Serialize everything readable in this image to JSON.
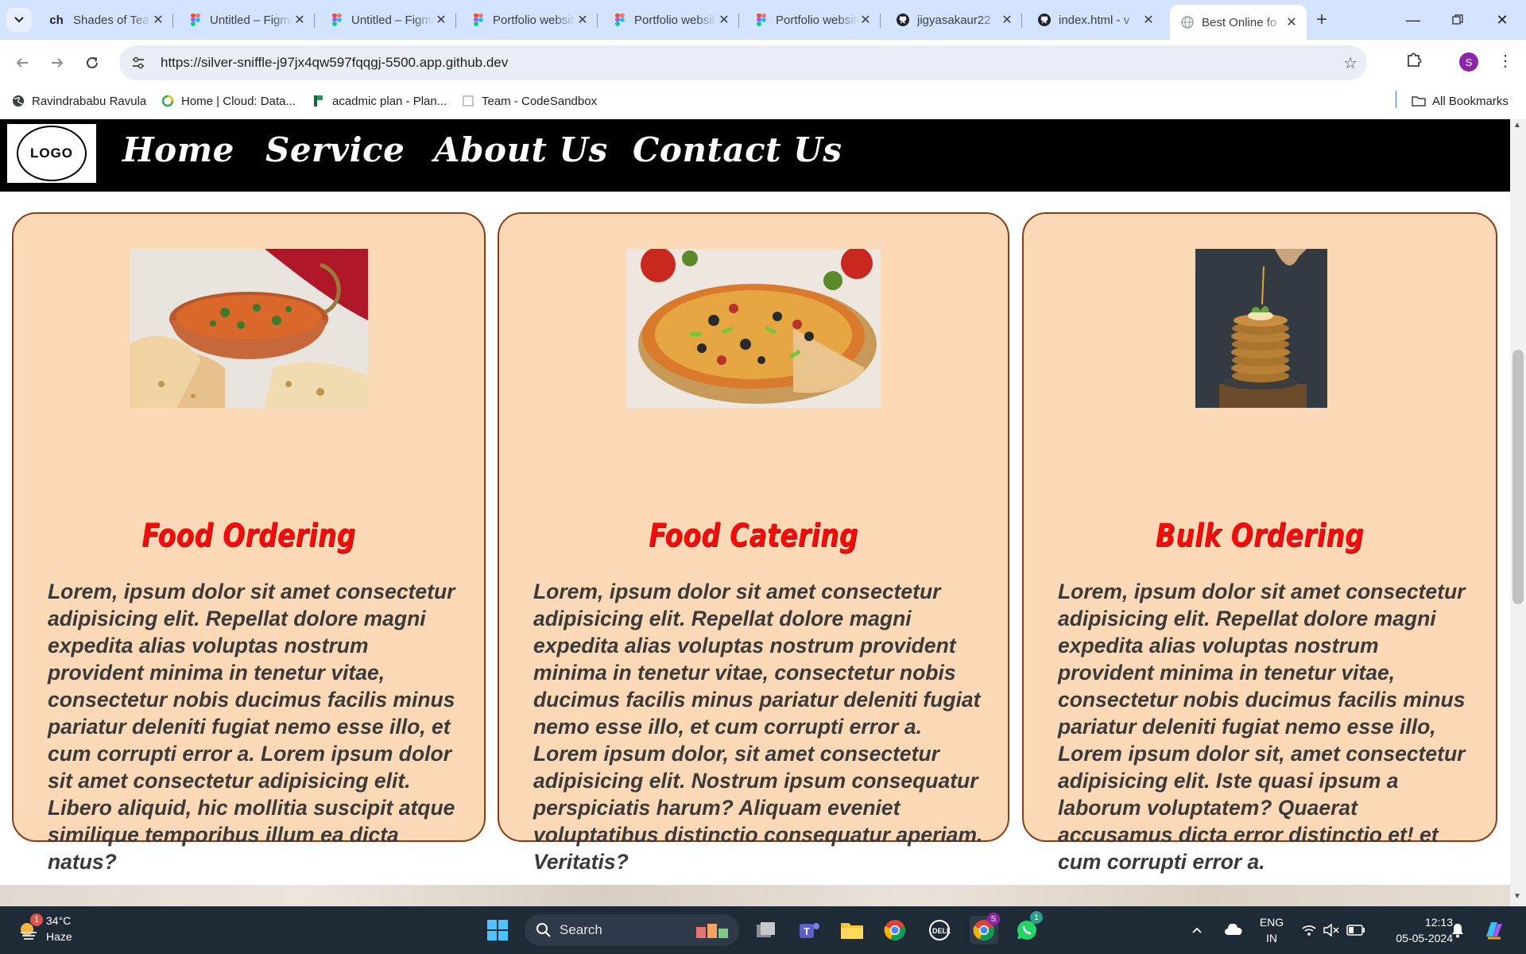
{
  "browser": {
    "tabs": [
      {
        "title": "Shades of Tea",
        "favicon": "ch",
        "active": false
      },
      {
        "title": "Untitled – Figma",
        "favicon": "figma",
        "active": false
      },
      {
        "title": "Untitled – Figma",
        "favicon": "figma",
        "active": false
      },
      {
        "title": "Portfolio website",
        "favicon": "figma",
        "active": false
      },
      {
        "title": "Portfolio website",
        "favicon": "figma",
        "active": false
      },
      {
        "title": "Portfolio website",
        "favicon": "figma",
        "active": false
      },
      {
        "title": "jigyasakaur22",
        "favicon": "github",
        "active": false
      },
      {
        "title": "index.html - v",
        "favicon": "github",
        "active": false
      },
      {
        "title": "Best Online fo",
        "favicon": "globe",
        "active": true
      }
    ],
    "url": "https://silver-sniffle-j97jx4qw597fqqgj-5500.app.github.dev",
    "profile_initial": "S",
    "bookmarks": [
      {
        "label": "Ravindrababu Ravula",
        "icon": "globe-icon"
      },
      {
        "label": "Home | Cloud: Data...",
        "icon": "ring-icon"
      },
      {
        "label": "acadmic plan - Plan...",
        "icon": "flag-icon"
      },
      {
        "label": "Team - CodeSandbox",
        "icon": "square-icon"
      }
    ],
    "all_bookmarks": "All Bookmarks"
  },
  "site": {
    "logo": "LOGO",
    "nav": [
      "Home",
      "Service",
      "About Us",
      "Contact Us"
    ],
    "cards": [
      {
        "title": "Food Ordering",
        "image": "curry-bowl-with-naan",
        "text": "Lorem, ipsum dolor sit amet consectetur adipisicing elit. Repellat dolore magni expedita alias voluptas nostrum provident minima in tenetur vitae, consectetur nobis ducimus facilis minus pariatur deleniti fugiat nemo esse illo, et cum corrupti error a. Lorem ipsum dolor sit amet consectetur adipisicing elit. Libero aliquid, hic mollitia suscipit atque similique temporibus illum ea dicta natus?"
      },
      {
        "title": "Food Catering",
        "image": "pizza",
        "text": "Lorem, ipsum dolor sit amet consectetur adipisicing elit. Repellat dolore magni expedita alias voluptas nostrum provident minima in tenetur vitae, consectetur nobis ducimus facilis minus pariatur deleniti fugiat nemo esse illo, et cum corrupti error a. Lorem ipsum dolor, sit amet consectetur adipisicing elit. Nostrum ipsum consequatur perspiciatis harum? Aliquam eveniet voluptatibus distinctio consequatur aperiam. Veritatis?"
      },
      {
        "title": "Bulk Ordering",
        "image": "pancake-stack",
        "text": "Lorem, ipsum dolor sit amet consectetur adipisicing elit. Repellat dolore magni expedita alias voluptas nostrum provident minima in tenetur vitae, consectetur nobis ducimus facilis minus pariatur deleniti fugiat nemo esse illo, Lorem ipsum dolor sit, amet consectetur adipisicing elit. Iste quasi ipsum a laborum voluptatem? Quaerat accusamus dicta error distinctio et! et cum corrupti error a."
      }
    ]
  },
  "taskbar": {
    "weather_temp": "34°C",
    "weather_desc": "Haze",
    "weather_badge": "1",
    "search_label": "Search",
    "lang_1": "ENG",
    "lang_2": "IN",
    "time": "12:13",
    "date": "05-05-2024",
    "whatsapp_badge": "1",
    "chrome_profile_badge": "S"
  },
  "colors": {
    "card_bg": "#fcd9b6",
    "card_border": "#8b3c12",
    "card_title": "#f20d0d",
    "nav_bg": "#000000"
  }
}
